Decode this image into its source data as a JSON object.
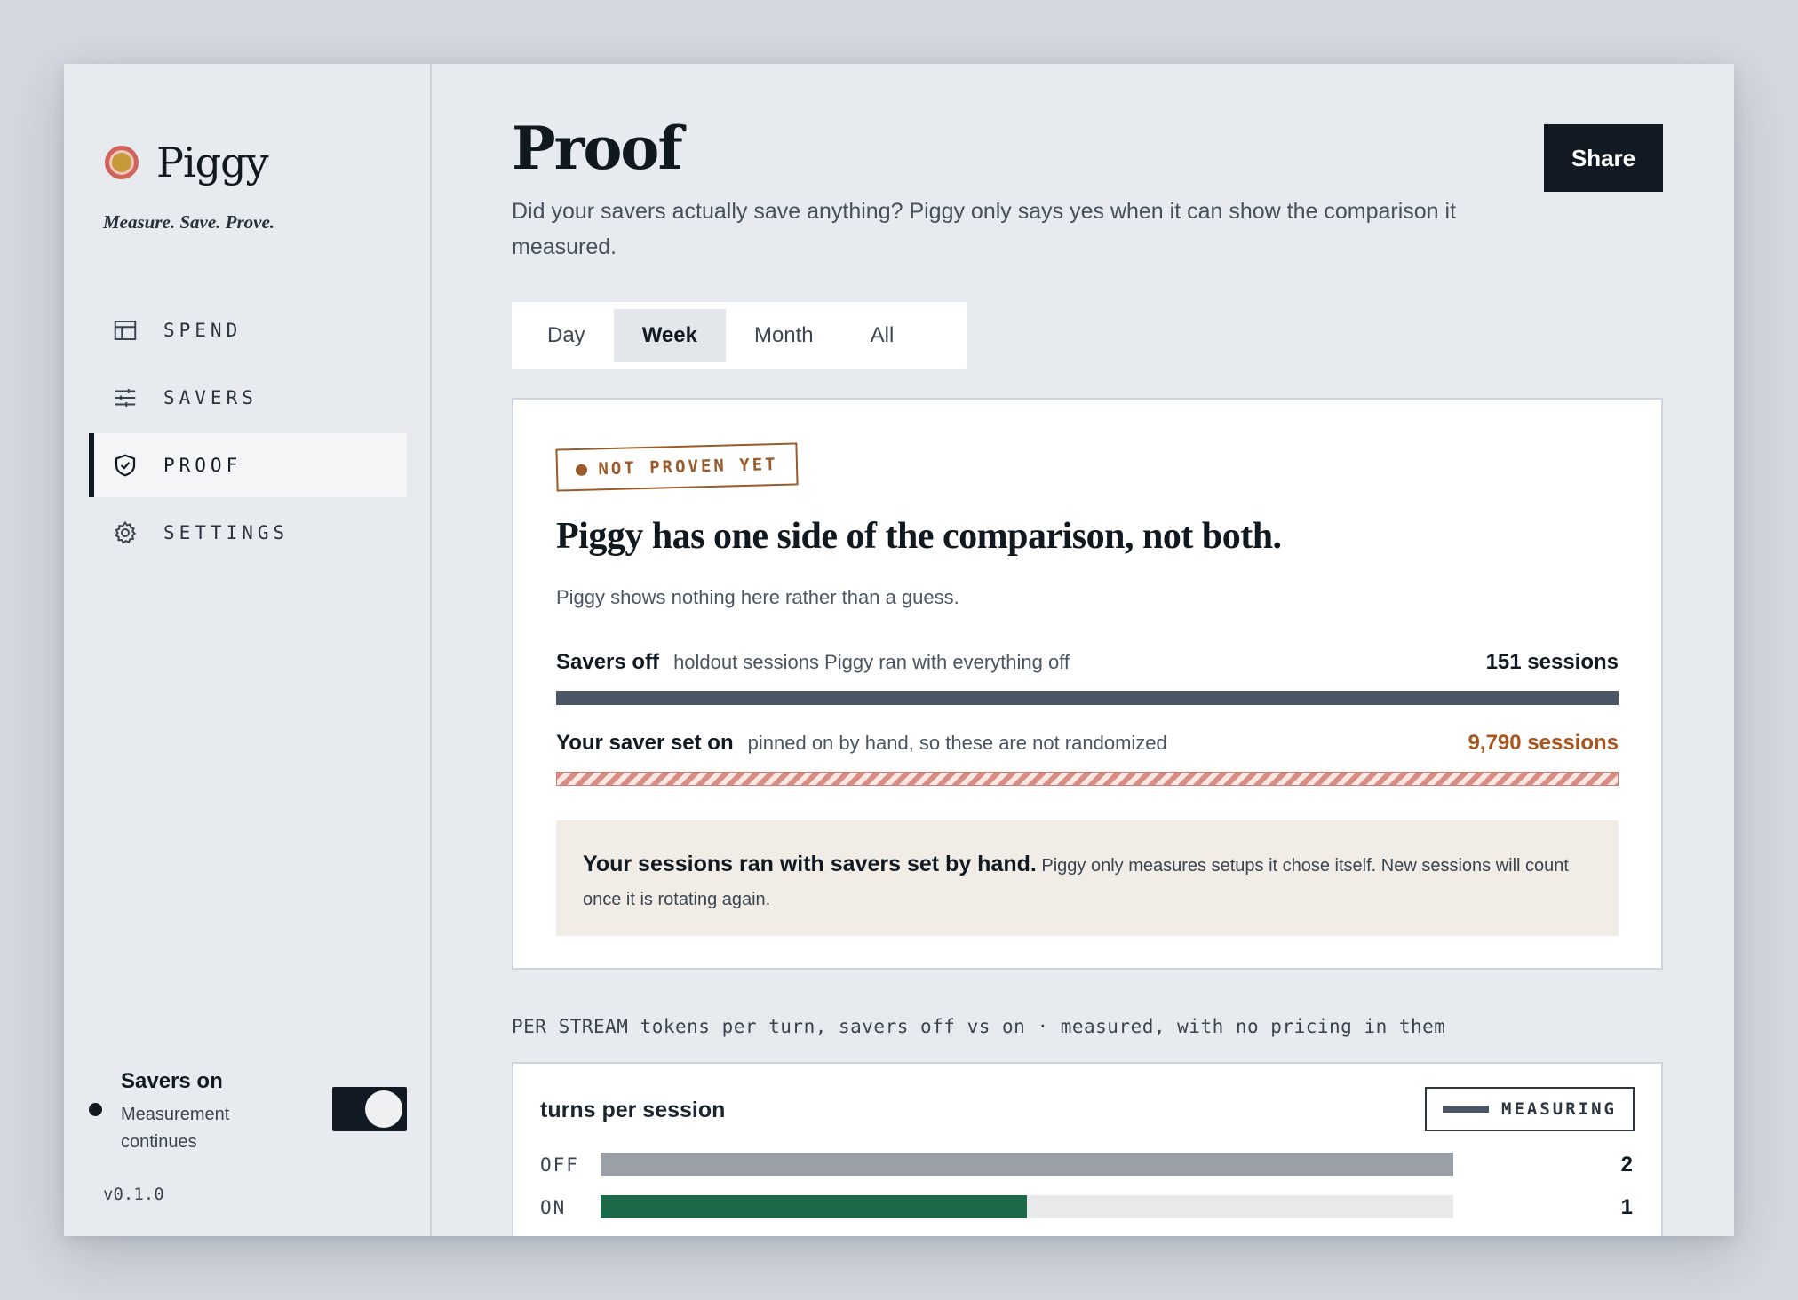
{
  "brand": {
    "name": "Piggy",
    "tagline": "Measure. Save. Prove."
  },
  "nav": [
    {
      "label": "SPEND",
      "icon": "layout-icon"
    },
    {
      "label": "SAVERS",
      "icon": "sliders-icon"
    },
    {
      "label": "PROOF",
      "icon": "shield-check-icon",
      "active": true
    },
    {
      "label": "SETTINGS",
      "icon": "gear-icon"
    }
  ],
  "status": {
    "title": "Savers on",
    "subtitle": "Measurement continues",
    "toggle_on": true
  },
  "version": "v0.1.0",
  "page": {
    "title": "Proof",
    "description": "Did your savers actually save anything? Piggy only says yes when it can show the comparison it measured.",
    "share_label": "Share"
  },
  "tabs": [
    {
      "label": "Day"
    },
    {
      "label": "Week",
      "active": true
    },
    {
      "label": "Month"
    },
    {
      "label": "All"
    }
  ],
  "proof_card": {
    "stamp": "NOT PROVEN YET",
    "headline": "Piggy has one side of the comparison, not both.",
    "subtitle": "Piggy shows nothing here rather than a guess.",
    "rows": [
      {
        "name": "Savers off",
        "note": "holdout sessions Piggy ran with everything off",
        "count": "151 sessions"
      },
      {
        "name": "Your saver set on",
        "note": "pinned on by hand, so these are not randomized",
        "count": "9,790 sessions"
      }
    ],
    "callout_bold": "Your sessions ran with savers set by hand.",
    "callout_text": "Piggy only measures setups it chose itself. New sessions will count once it is rotating again."
  },
  "stream": {
    "caption": "PER STREAM tokens per turn, savers off vs on · measured, with no pricing in them",
    "chart": {
      "title": "turns per session",
      "badge": "MEASURING",
      "rows": [
        {
          "label": "OFF",
          "value": 2,
          "display": "2",
          "color": "#9aa0a6"
        },
        {
          "label": "ON",
          "value": 1,
          "display": "1",
          "color": "#1d6a4a"
        }
      ],
      "max": 2
    }
  },
  "colors": {
    "accent": "#111a23",
    "warning": "#a8561f",
    "positive": "#1d6a4a"
  }
}
